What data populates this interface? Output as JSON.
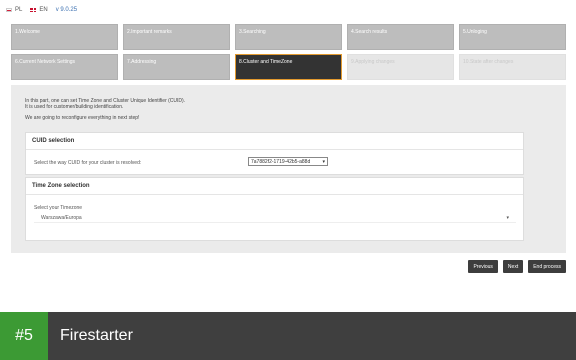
{
  "topbar": {
    "lang_pl": "PL",
    "lang_en": "EN",
    "version": "v 9.0.25"
  },
  "steps": {
    "row1": [
      "1.Welcome",
      "2.Important remarks",
      "3.Searching",
      "4.Search results",
      "5.Unloging"
    ],
    "row2": [
      "6.Current Network Settings",
      "7.Addressing",
      "8.Cluster and TimeZone",
      "9.Applying changes",
      "10.State after changes"
    ]
  },
  "intro": {
    "line1": "In this part, one can set Time Zone and Cluster Unique Identifier (CUID).",
    "line2": "It is used for customer/building identification.",
    "line3": "We are going to reconfigure everything in next step!"
  },
  "cuid": {
    "title": "CUID selection",
    "label": "Select the way CUID for your cluster is resolved:",
    "value": "7a7882f2-1719-42b5-a88d"
  },
  "timezone": {
    "title": "Time Zone selection",
    "label": "Select your Timezone",
    "value": "Warszawa/Europa"
  },
  "buttons": {
    "previous": "Previous",
    "next": "Next",
    "end": "End process"
  },
  "footer": {
    "rank": "#5",
    "app_name": "Firestarter"
  },
  "colors": {
    "active_step_border": "#e39a2f",
    "rank_badge": "#3c9a34",
    "version_text": "#3a6fb0"
  }
}
